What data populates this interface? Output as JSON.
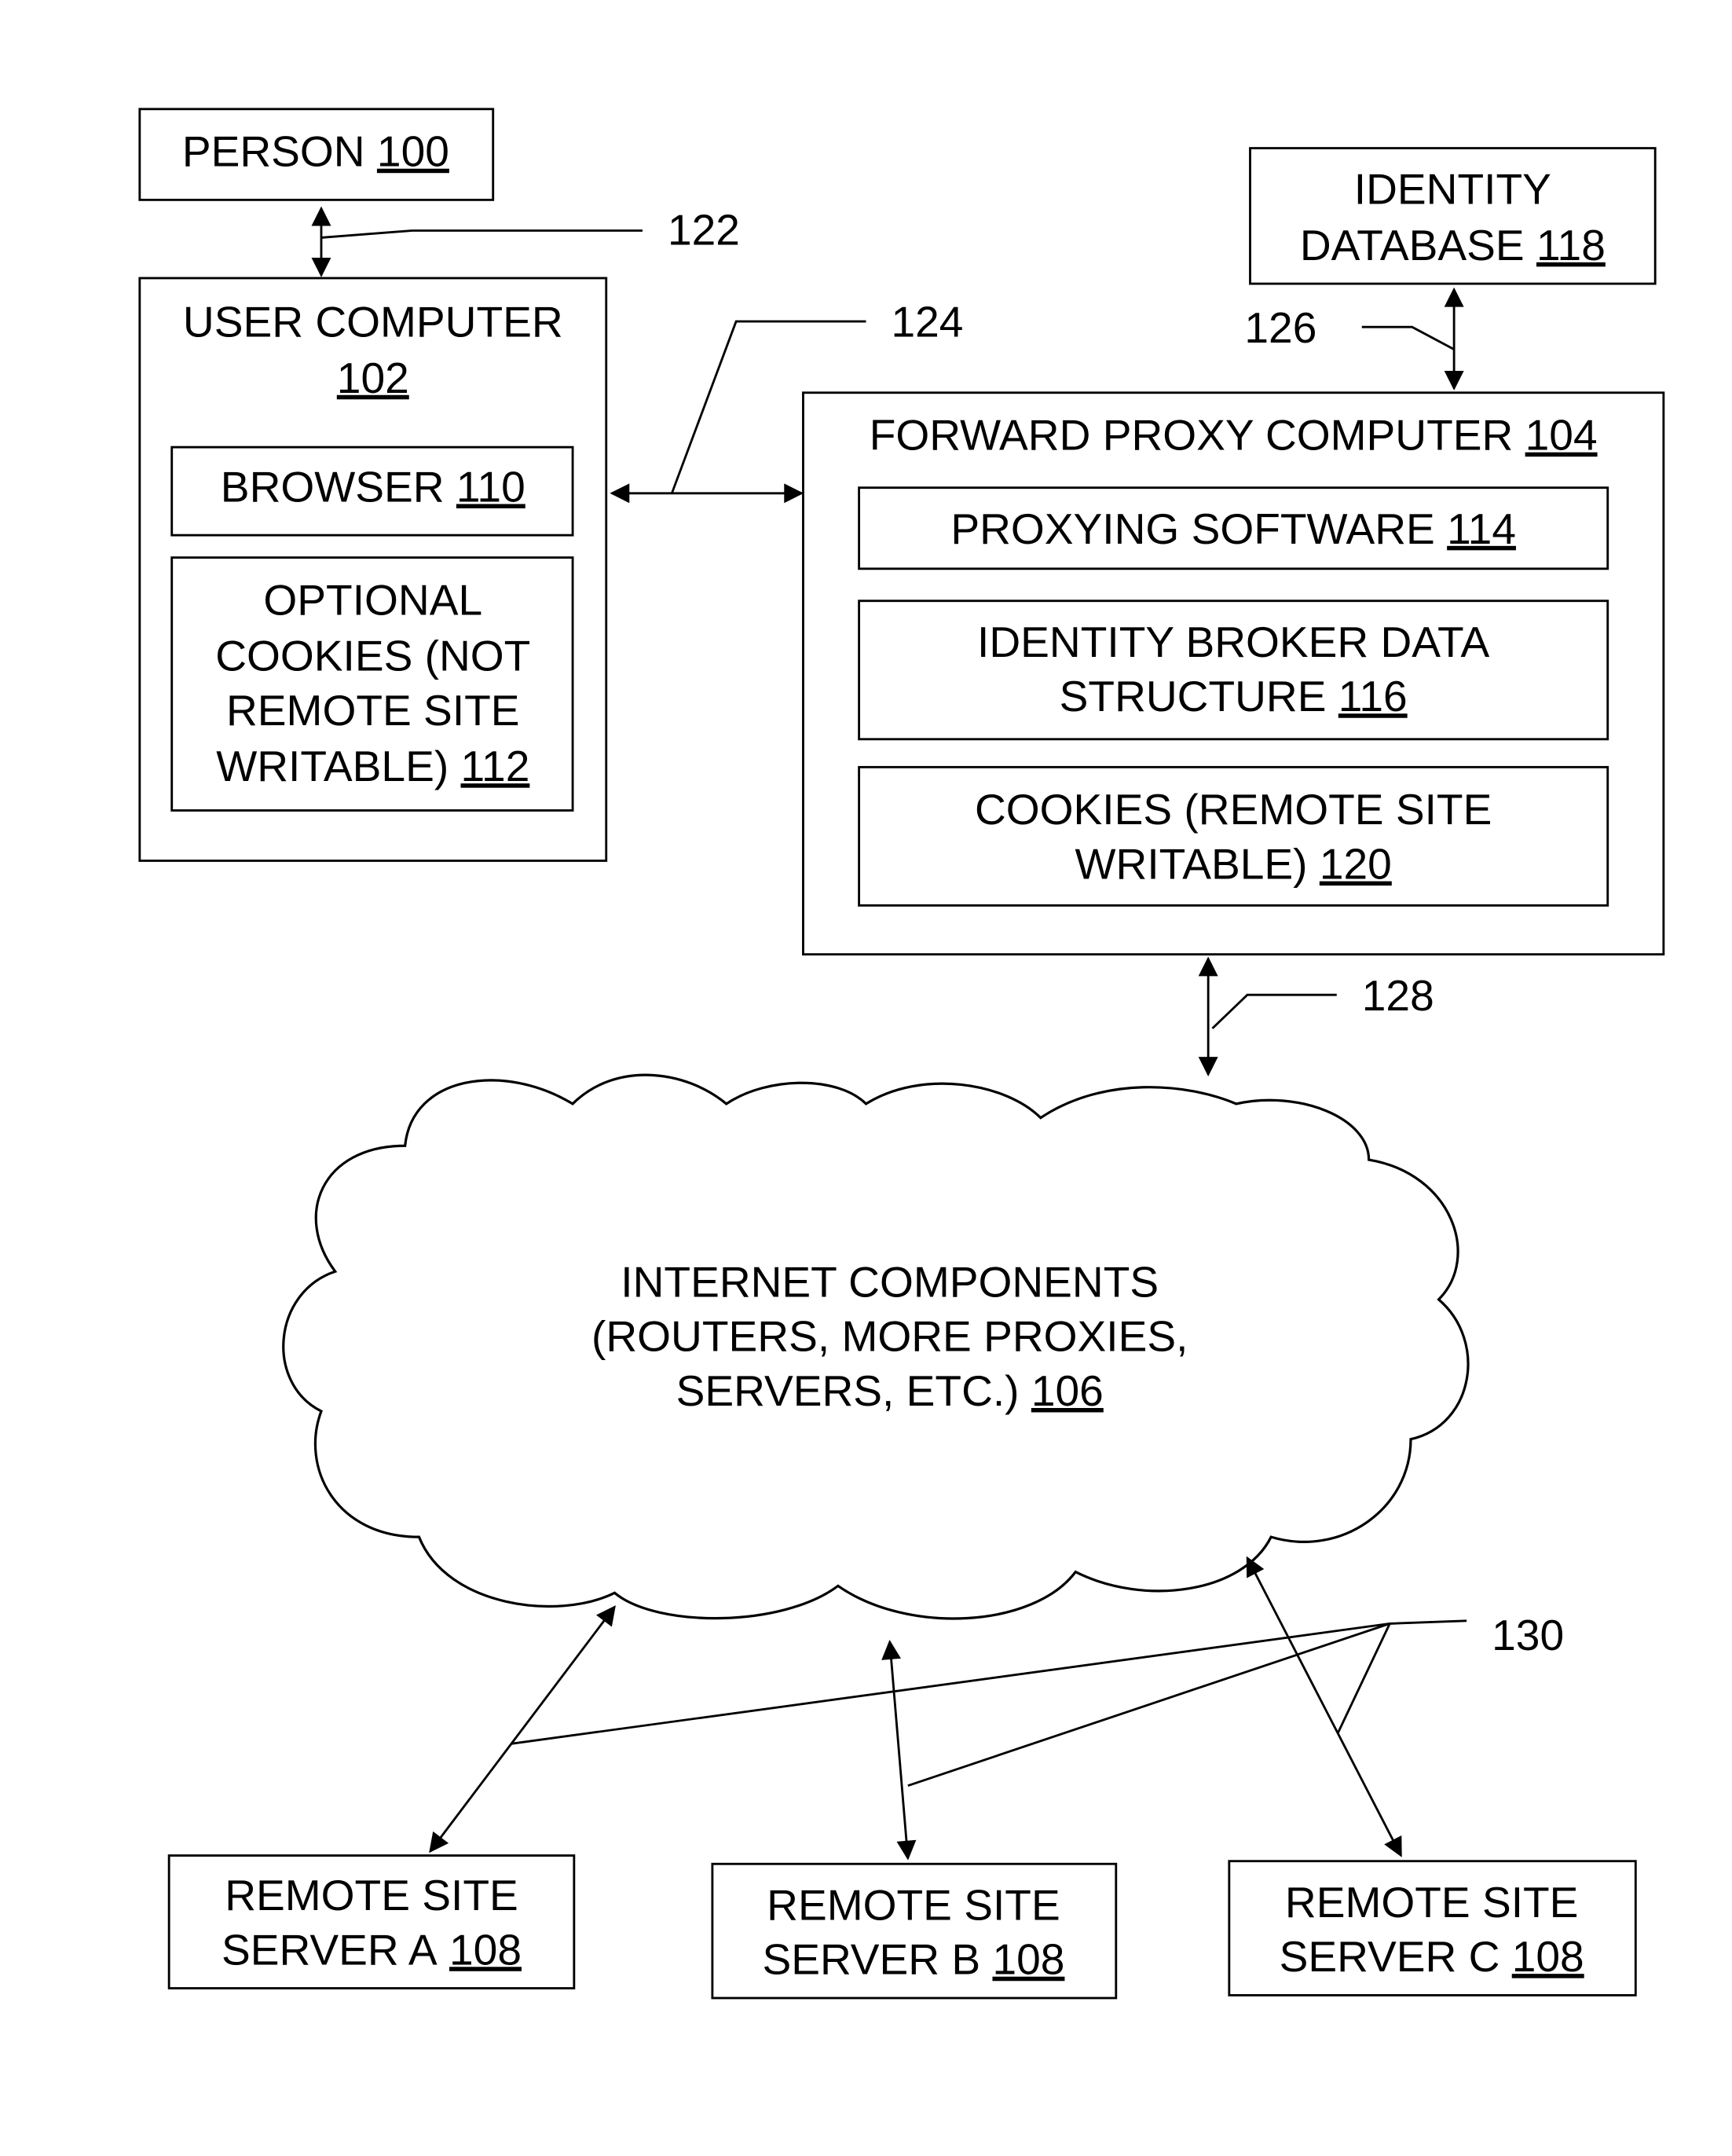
{
  "diagram": {
    "person": {
      "label": "PERSON",
      "ref": "100"
    },
    "user_computer": {
      "label": "USER COMPUTER",
      "ref": "102"
    },
    "browser": {
      "label": "BROWSER",
      "ref": "110"
    },
    "optional_cookies": {
      "lines": [
        "OPTIONAL",
        "COOKIES (NOT",
        "REMOTE SITE",
        "WRITABLE)"
      ],
      "ref": "112"
    },
    "identity_database": {
      "lines": [
        "IDENTITY",
        "DATABASE"
      ],
      "ref": "118"
    },
    "forward_proxy": {
      "label": "FORWARD PROXY COMPUTER",
      "ref": "104"
    },
    "proxying_software": {
      "label": "PROXYING SOFTWARE",
      "ref": "114"
    },
    "identity_broker": {
      "lines": [
        "IDENTITY BROKER DATA",
        "STRUCTURE"
      ],
      "ref": "116"
    },
    "proxy_cookies": {
      "lines": [
        "COOKIES (REMOTE SITE",
        "WRITABLE)"
      ],
      "ref": "120"
    },
    "internet": {
      "lines": [
        "INTERNET COMPONENTS",
        "(ROUTERS, MORE PROXIES,",
        "SERVERS, ETC.)"
      ],
      "ref": "106"
    },
    "servers": [
      {
        "line1": "REMOTE SITE",
        "line2": "SERVER A",
        "ref": "108"
      },
      {
        "line1": "REMOTE SITE",
        "line2": "SERVER B",
        "ref": "108"
      },
      {
        "line1": "REMOTE SITE",
        "line2": "SERVER C",
        "ref": "108"
      }
    ],
    "connection_refs": {
      "person_user": "122",
      "user_proxy": "124",
      "db_proxy": "126",
      "proxy_internet": "128",
      "internet_servers": "130"
    }
  }
}
